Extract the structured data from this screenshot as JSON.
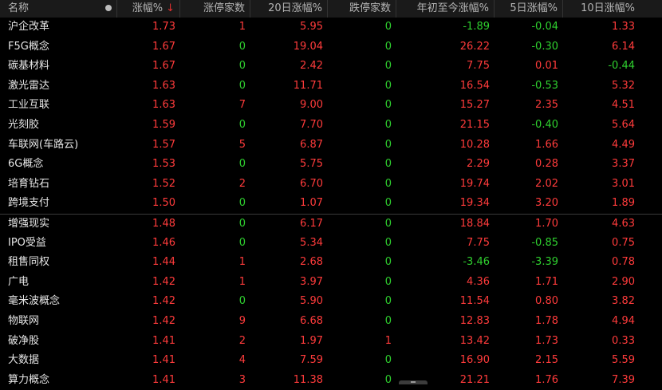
{
  "header": {
    "name": "名称",
    "change_pct": "涨幅%",
    "sort_arrow": "↓",
    "limit_up_count": "涨停家数",
    "change_20d": "20日涨幅%",
    "limit_down_count": "跌停家数",
    "ytd_change": "年初至今涨幅%",
    "change_5d": "5日涨幅%",
    "change_10d": "10日涨幅%"
  },
  "colors": {
    "up": "#ff3b3b",
    "down": "#2fd12f",
    "neutral": "#e6e6e6",
    "background": "#000000",
    "header_bg": "#1a1a1a"
  },
  "rows": [
    {
      "name": "沪企改革",
      "change_pct": "1.73",
      "limit_up": "1",
      "change_20d": "5.95",
      "limit_down": "0",
      "ytd": "-1.89",
      "d5": "-0.04",
      "d10": "1.33"
    },
    {
      "name": "F5G概念",
      "change_pct": "1.67",
      "limit_up": "0",
      "change_20d": "19.04",
      "limit_down": "0",
      "ytd": "26.22",
      "d5": "-0.30",
      "d10": "6.14"
    },
    {
      "name": "碳基材料",
      "change_pct": "1.67",
      "limit_up": "0",
      "change_20d": "2.42",
      "limit_down": "0",
      "ytd": "7.75",
      "d5": "0.01",
      "d10": "-0.44"
    },
    {
      "name": "激光雷达",
      "change_pct": "1.63",
      "limit_up": "0",
      "change_20d": "11.71",
      "limit_down": "0",
      "ytd": "16.54",
      "d5": "-0.53",
      "d10": "5.32"
    },
    {
      "name": "工业互联",
      "change_pct": "1.63",
      "limit_up": "7",
      "change_20d": "9.00",
      "limit_down": "0",
      "ytd": "15.27",
      "d5": "2.35",
      "d10": "4.51"
    },
    {
      "name": "光刻胶",
      "change_pct": "1.59",
      "limit_up": "0",
      "change_20d": "7.70",
      "limit_down": "0",
      "ytd": "21.15",
      "d5": "-0.40",
      "d10": "5.64"
    },
    {
      "name": "车联网(车路云)",
      "change_pct": "1.57",
      "limit_up": "5",
      "change_20d": "6.87",
      "limit_down": "0",
      "ytd": "10.28",
      "d5": "1.66",
      "d10": "4.49"
    },
    {
      "name": "6G概念",
      "change_pct": "1.53",
      "limit_up": "0",
      "change_20d": "5.75",
      "limit_down": "0",
      "ytd": "2.29",
      "d5": "0.28",
      "d10": "3.37"
    },
    {
      "name": "培育钻石",
      "change_pct": "1.52",
      "limit_up": "2",
      "change_20d": "6.70",
      "limit_down": "0",
      "ytd": "19.74",
      "d5": "2.02",
      "d10": "3.01"
    },
    {
      "name": "跨境支付",
      "change_pct": "1.50",
      "limit_up": "0",
      "change_20d": "1.07",
      "limit_down": "0",
      "ytd": "19.34",
      "d5": "3.20",
      "d10": "1.89"
    },
    {
      "name": "增强现实",
      "change_pct": "1.48",
      "limit_up": "0",
      "change_20d": "6.17",
      "limit_down": "0",
      "ytd": "18.84",
      "d5": "1.70",
      "d10": "4.63"
    },
    {
      "name": "IPO受益",
      "change_pct": "1.46",
      "limit_up": "0",
      "change_20d": "5.34",
      "limit_down": "0",
      "ytd": "7.75",
      "d5": "-0.85",
      "d10": "0.75"
    },
    {
      "name": "租售同权",
      "change_pct": "1.44",
      "limit_up": "1",
      "change_20d": "2.68",
      "limit_down": "0",
      "ytd": "-3.46",
      "d5": "-3.39",
      "d10": "0.78"
    },
    {
      "name": "广电",
      "change_pct": "1.42",
      "limit_up": "1",
      "change_20d": "3.97",
      "limit_down": "0",
      "ytd": "4.36",
      "d5": "1.71",
      "d10": "2.90"
    },
    {
      "name": "毫米波概念",
      "change_pct": "1.42",
      "limit_up": "0",
      "change_20d": "5.90",
      "limit_down": "0",
      "ytd": "11.54",
      "d5": "0.80",
      "d10": "3.82"
    },
    {
      "name": "物联网",
      "change_pct": "1.42",
      "limit_up": "9",
      "change_20d": "6.68",
      "limit_down": "0",
      "ytd": "12.83",
      "d5": "1.78",
      "d10": "4.94"
    },
    {
      "name": "破净股",
      "change_pct": "1.41",
      "limit_up": "2",
      "change_20d": "1.97",
      "limit_down": "1",
      "ytd": "13.42",
      "d5": "1.73",
      "d10": "0.33"
    },
    {
      "name": "大数据",
      "change_pct": "1.41",
      "limit_up": "4",
      "change_20d": "7.59",
      "limit_down": "0",
      "ytd": "16.90",
      "d5": "2.15",
      "d10": "5.59"
    },
    {
      "name": "算力概念",
      "change_pct": "1.41",
      "limit_up": "3",
      "change_20d": "11.38",
      "limit_down": "0",
      "ytd": "21.21",
      "d5": "1.76",
      "d10": "7.39"
    }
  ]
}
